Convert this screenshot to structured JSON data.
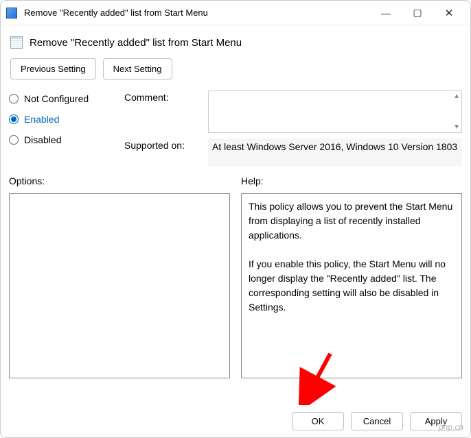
{
  "window": {
    "title": "Remove \"Recently added\" list from Start Menu"
  },
  "header": {
    "title": "Remove \"Recently added\" list from Start Menu"
  },
  "nav": {
    "previous": "Previous Setting",
    "next": "Next Setting"
  },
  "states": {
    "not_configured": "Not Configured",
    "enabled": "Enabled",
    "disabled": "Disabled",
    "selected": "enabled"
  },
  "fields": {
    "comment_label": "Comment:",
    "comment_value": "",
    "supported_label": "Supported on:",
    "supported_value": "At least Windows Server 2016, Windows 10 Version 1803"
  },
  "lower": {
    "options_label": "Options:",
    "options_value": "",
    "help_label": "Help:",
    "help_value": "This policy allows you to prevent the Start Menu from displaying a list of recently installed applications.\n\nIf you enable this policy, the Start Menu will no longer display the \"Recently added\" list. The corresponding setting will also be disabled in Settings."
  },
  "footer": {
    "ok": "OK",
    "cancel": "Cancel",
    "apply": "Apply"
  },
  "watermark": "php.cn"
}
